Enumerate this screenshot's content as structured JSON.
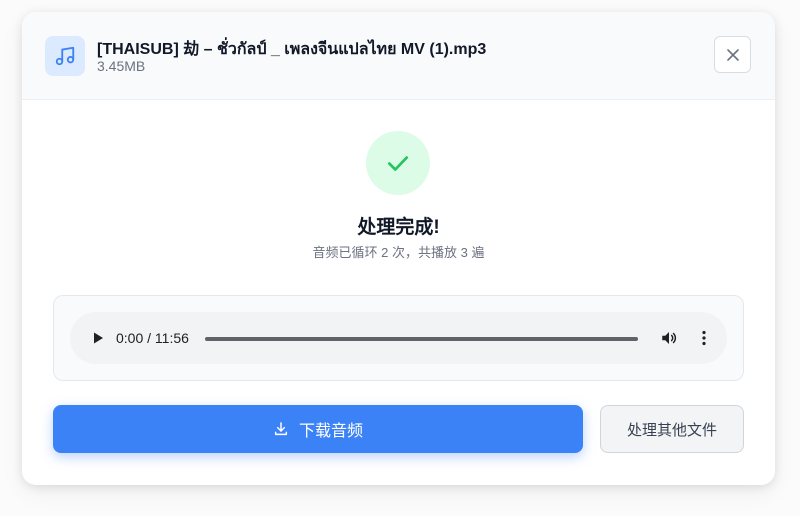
{
  "file": {
    "name": "[THAISUB] 劫 – ชั่วกัลป์ _ เพลงจีนแปลไทย MV (1).mp3",
    "size": "3.45MB",
    "icon": "music-note-icon"
  },
  "status": {
    "title": "处理完成!",
    "detail": "音频已循环 2 次，共播放 3 遍",
    "icon": "check-icon"
  },
  "player": {
    "time": "0:00 / 11:56",
    "progress": 0
  },
  "actions": {
    "download_label": "下载音频",
    "other_label": "处理其他文件"
  },
  "colors": {
    "accent": "#3b82f6",
    "success": "#22c55e",
    "success_bg": "#dcfce7",
    "file_icon_bg": "#dbeafe"
  }
}
